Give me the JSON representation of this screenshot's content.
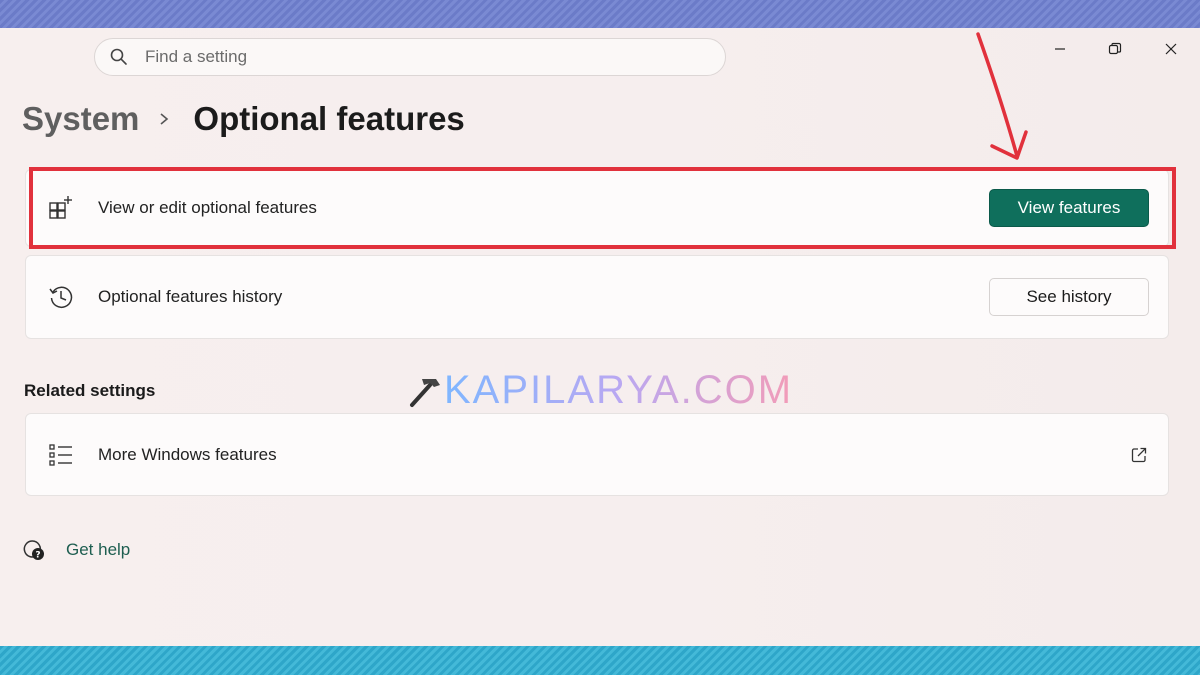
{
  "search": {
    "placeholder": "Find a setting"
  },
  "window_controls": [
    "minimize-icon",
    "restore-icon",
    "close-icon"
  ],
  "breadcrumb": {
    "parent": "System",
    "current": "Optional features"
  },
  "cards": [
    {
      "label": "View or edit optional features",
      "icon": "add-app-grid-icon",
      "button": "View features"
    },
    {
      "label": "Optional features history",
      "icon": "history-icon",
      "button": "See history"
    }
  ],
  "related": {
    "heading": "Related settings",
    "items": [
      {
        "label": "More Windows features",
        "icon": "list-icon",
        "action_icon": "open-external-icon"
      }
    ]
  },
  "help": {
    "label": "Get help",
    "icon": "help-chat-icon"
  },
  "watermark": {
    "text": "KAPILARYA.COM"
  },
  "colors": {
    "accent": "#0f6f5c",
    "highlight": "#e1313c",
    "background": "#f7efee"
  }
}
